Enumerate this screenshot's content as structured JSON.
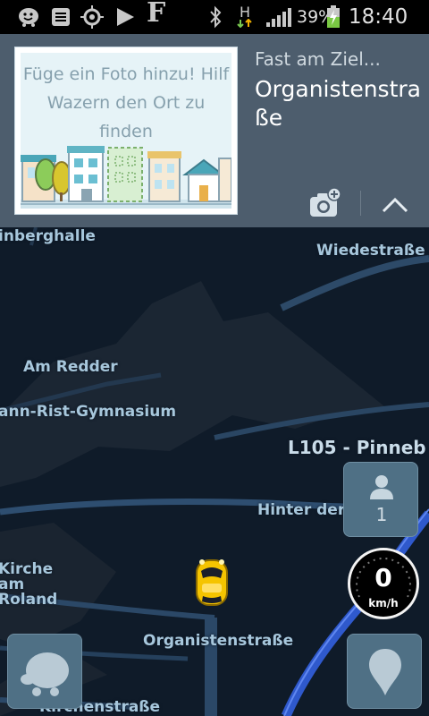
{
  "status_bar": {
    "battery_percent": "39%",
    "time": "18:40",
    "network_type": "H",
    "app_letter": "F",
    "icons": [
      "waze-face-icon",
      "keyboard-icon",
      "gps-icon",
      "play-store-icon",
      "f-app-icon",
      "bluetooth-icon",
      "h-data-icon",
      "signal-icon",
      "battery-charging-icon"
    ]
  },
  "banner": {
    "photo_prompt": "Füge ein Foto hinzu! Hilf Wazern den Ort zu finden",
    "near_label": "Fast am Ziel...",
    "street_title": "Organistenstraße",
    "camera_icon": "camera-add-icon",
    "collapse_icon": "chevron-up-icon"
  },
  "map": {
    "labels": {
      "steinberghalle": "inberghalle",
      "wiedestrasse": "Wiedestraße",
      "am_redder": "Am Redder",
      "gymnasium": "ann-Rist-Gymnasium",
      "l105": "L105 - Pinneb",
      "hinter_der_kirche": "Hinter der Kirche",
      "kirche_am_roland": "Kirche am Roland",
      "organistenstrasse": "Organistenstraße",
      "kirchenstrasse": "Kirchenstraße"
    },
    "user_count": "1",
    "speed": "0",
    "speed_unit": "km/h"
  },
  "colors": {
    "banner_bg": "#4d5d6d",
    "map_bg": "#0f1b29",
    "road_highlight": "#3561d8",
    "car_yellow": "#f5c400"
  }
}
